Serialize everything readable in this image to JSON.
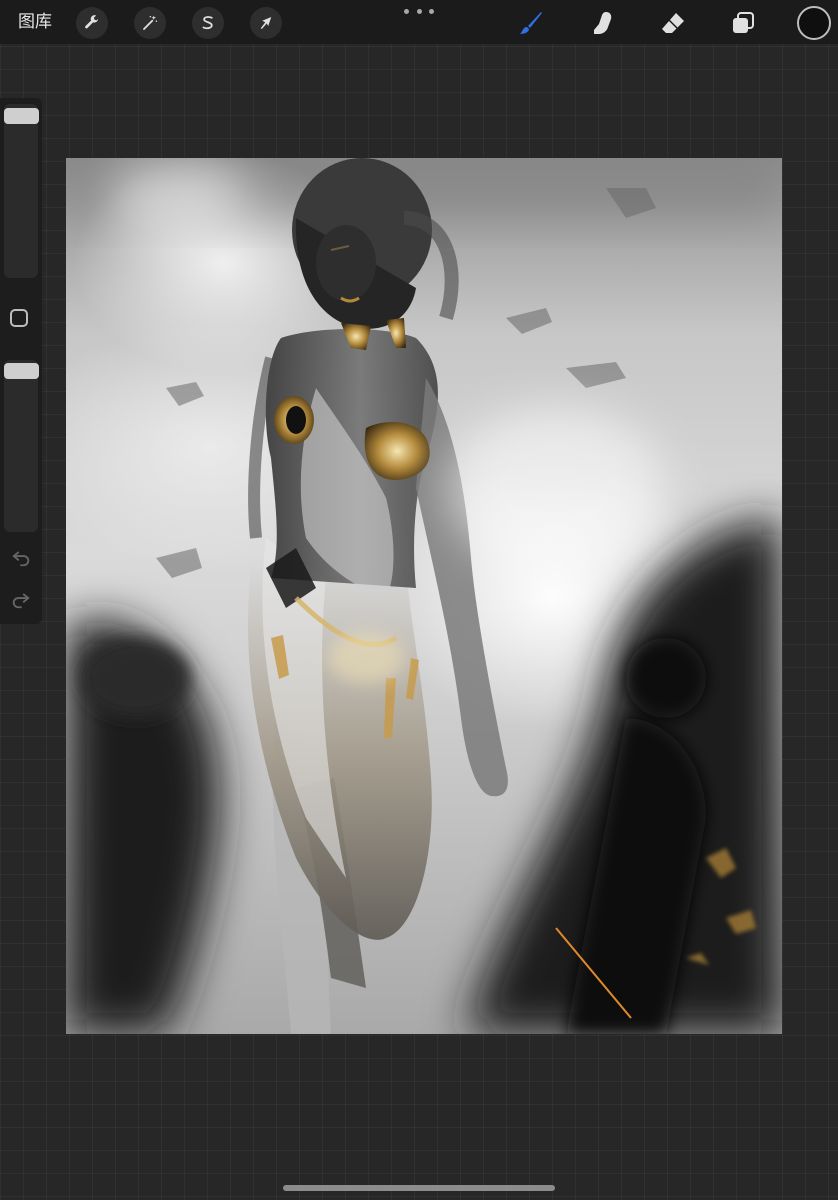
{
  "toolbar": {
    "gallery_label": "图库",
    "icons": {
      "actions": "wrench-icon",
      "adjustments": "magic-wand-icon",
      "selection": "selection-s-icon",
      "transform": "arrow-cursor-icon",
      "more": "more-dots-icon",
      "brush": "brush-icon",
      "smudge": "smudge-finger-icon",
      "eraser": "eraser-icon",
      "layers": "layers-icon"
    },
    "brush_active_color": "#2f6fe0",
    "current_color": "#0f0f0f"
  },
  "sidebar": {
    "icons": {
      "modify": "square-modify-icon",
      "undo": "undo-icon",
      "redo": "redo-icon"
    }
  },
  "canvas": {
    "subject": "painting"
  }
}
